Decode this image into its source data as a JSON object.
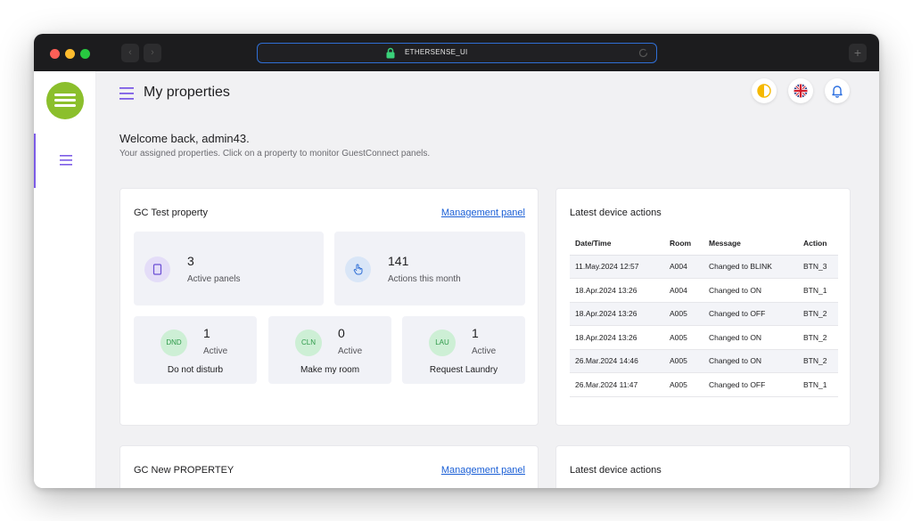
{
  "browser": {
    "url": "ETHERSENSE_UI"
  },
  "header": {
    "title": "My properties"
  },
  "welcome": {
    "heading": "Welcome back, admin43.",
    "subtext": "Your assigned properties. Click on a property to monitor GuestConnect panels."
  },
  "properties": [
    {
      "name": "GC Test property",
      "link_label": "Management panel",
      "stats": [
        {
          "value": "3",
          "label": "Active panels",
          "icon": "tablet-icon",
          "color": "#e4ddf8"
        },
        {
          "value": "141",
          "label": "Actions this month",
          "icon": "pointer-hand-icon",
          "color": "#d9e6f7"
        }
      ],
      "services": [
        {
          "code": "DND",
          "value": "1",
          "status": "Active",
          "name": "Do not disturb"
        },
        {
          "code": "CLN",
          "value": "0",
          "status": "Active",
          "name": "Make my room"
        },
        {
          "code": "LAU",
          "value": "1",
          "status": "Active",
          "name": "Request Laundry"
        }
      ]
    },
    {
      "name": "GC New PROPERTEY",
      "link_label": "Management panel"
    }
  ],
  "device_actions": [
    {
      "title": "Latest device actions",
      "columns": [
        "Date/Time",
        "Room",
        "Message",
        "Action"
      ],
      "rows": [
        [
          "11.May.2024 12:57",
          "A004",
          "Changed to BLINK",
          "BTN_3"
        ],
        [
          "18.Apr.2024 13:26",
          "A004",
          "Changed to ON",
          "BTN_1"
        ],
        [
          "18.Apr.2024 13:26",
          "A005",
          "Changed to OFF",
          "BTN_2"
        ],
        [
          "18.Apr.2024 13:26",
          "A005",
          "Changed to ON",
          "BTN_2"
        ],
        [
          "26.Mar.2024 14:46",
          "A005",
          "Changed to ON",
          "BTN_2"
        ],
        [
          "26.Mar.2024 11:47",
          "A005",
          "Changed to OFF",
          "BTN_1"
        ]
      ]
    },
    {
      "title": "Latest device actions"
    }
  ],
  "colors": {
    "accent": "#7c5ce6",
    "logo": "#8bbf2c",
    "link": "#1a5fd6",
    "service_green": "#cdefd5"
  }
}
